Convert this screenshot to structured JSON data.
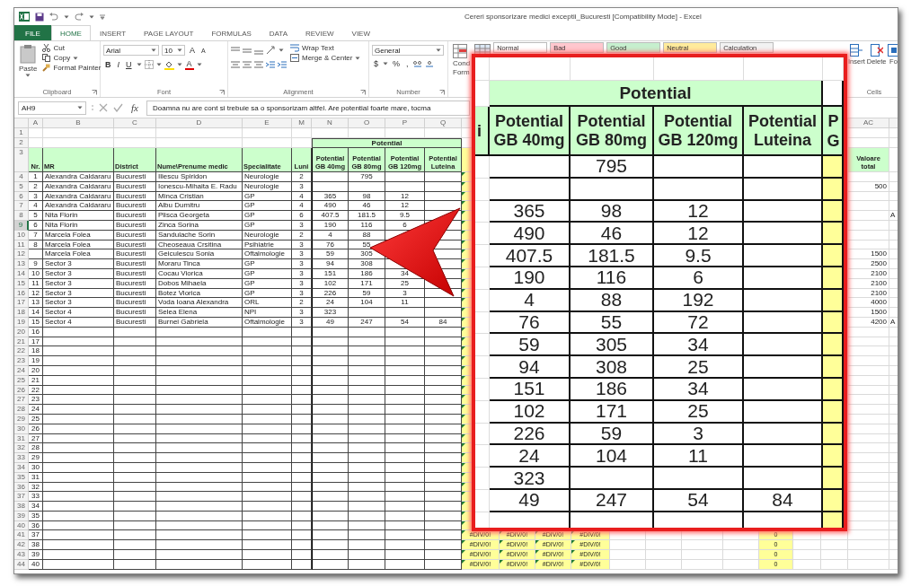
{
  "title_bar": {
    "title": "Cereri sponsorizare medici exceptii_Bucuresti  [Compatibility Mode] - Excel"
  },
  "ribbon_tabs": [
    {
      "label": "FILE",
      "kind": "file",
      "selected": false
    },
    {
      "label": "HOME",
      "kind": "tab",
      "selected": true
    },
    {
      "label": "INSERT",
      "kind": "tab",
      "selected": false
    },
    {
      "label": "PAGE LAYOUT",
      "kind": "tab",
      "selected": false
    },
    {
      "label": "FORMULAS",
      "kind": "tab",
      "selected": false
    },
    {
      "label": "DATA",
      "kind": "tab",
      "selected": false
    },
    {
      "label": "REVIEW",
      "kind": "tab",
      "selected": false
    },
    {
      "label": "VIEW",
      "kind": "tab",
      "selected": false
    }
  ],
  "ribbon": {
    "clipboard": {
      "paste": "Paste",
      "cut": "Cut",
      "copy": "Copy",
      "format_painter": "Format Painter",
      "label": "Clipboard"
    },
    "font": {
      "name": "Arial",
      "size": "10",
      "grow": "A",
      "shrink": "A",
      "bold": "B",
      "italic": "I",
      "underline": "U",
      "font_color": "A",
      "label": "Font"
    },
    "alignment": {
      "wrap": "Wrap Text",
      "merge": "Merge & Center",
      "label": "Alignment"
    },
    "number": {
      "format": "General",
      "currency": "$",
      "percent": "%",
      "comma": ",",
      "label": "Number"
    },
    "styles": {
      "conditional": [
        "Cond",
        "Form"
      ],
      "gallery": [
        {
          "label": "Normal",
          "color": "#ffffff"
        },
        {
          "label": "Bad",
          "color": "#ffc7ce"
        },
        {
          "label": "Good",
          "color": "#c6efce"
        },
        {
          "label": "Neutral",
          "color": "#ffeb9c"
        },
        {
          "label": "Calculation",
          "color": "#f2f2f2"
        }
      ]
    },
    "cells": {
      "insert": "Insert",
      "delete": "Delete",
      "format": "Fo",
      "label": "Cells"
    }
  },
  "formula_bar": {
    "name_box": "AH9",
    "function_label": "fx",
    "formula": "Doamna nu are cont si trebuie sa o sponsorizam altfel. Are potential foarte mare, tocma"
  },
  "sheet": {
    "column_headers": [
      "A",
      "B",
      "C",
      "D",
      "E",
      "M",
      "N",
      "O",
      "P",
      "Q",
      "AC"
    ],
    "row1": {
      "number": "1",
      "selected": false
    },
    "band_row": {
      "number": "2",
      "selected": false,
      "title": "Potential"
    },
    "header_row": {
      "number": "3",
      "selected": false,
      "nr": "Nr.",
      "mr": "MR",
      "district": "District",
      "doctor": "Nume\\Prenume medic",
      "specialty": "Specialitate",
      "months": "Luni",
      "gb40": "Potential GB 40mg",
      "gb80": "Potential GB 80mg",
      "gb120": "Potential GB 120mg",
      "luteina": "Potential Luteina",
      "total": "Valoare total"
    },
    "rows": [
      {
        "number": "4",
        "selected": false,
        "nr": "1",
        "mr": "Alexandra Caldararu",
        "district": "Bucuresti",
        "doctor": "Iliescu Spiridon",
        "specialty": "Neurologie",
        "months": "2",
        "gb80": "795"
      },
      {
        "number": "5",
        "selected": false,
        "nr": "2",
        "mr": "Alexandra Caldararu",
        "district": "Bucuresti",
        "doctor": "Ionescu-Mihaita E. Radu",
        "specialty": "Neurologie",
        "months": "3",
        "total": "500"
      },
      {
        "number": "6",
        "selected": false,
        "nr": "3",
        "mr": "Alexandra Caldararu",
        "district": "Bucuresti",
        "doctor": "Minca Cristian",
        "specialty": "GP",
        "months": "4",
        "gb40": "365",
        "gb80": "98",
        "gb120": "12"
      },
      {
        "number": "7",
        "selected": false,
        "nr": "4",
        "mr": "Alexandra Caldararu",
        "district": "Bucuresti",
        "doctor": "Albu Dumitru",
        "specialty": "GP",
        "months": "4",
        "gb40": "490",
        "gb80": "46",
        "gb120": "12"
      },
      {
        "number": "8",
        "selected": false,
        "nr": "5",
        "mr": "Nita Florin",
        "district": "Bucuresti",
        "doctor": "Plisca Georgeta",
        "specialty": "GP",
        "months": "6",
        "gb40": "407.5",
        "gb80": "181.5",
        "gb120": "9.5",
        "col_ad": "A"
      },
      {
        "number": "9",
        "selected": true,
        "nr": "6",
        "mr": "Nita Florin",
        "district": "Bucuresti",
        "doctor": "Zinca Sorina",
        "specialty": "GP",
        "months": "3",
        "gb40": "190",
        "gb80": "116",
        "gb120": "6"
      },
      {
        "number": "10",
        "selected": false,
        "nr": "7",
        "mr": "Marcela Folea",
        "district": "Bucuresti",
        "doctor": "Sandulache Sorin",
        "specialty": "Neurologie",
        "months": "2",
        "gb40": "4",
        "gb80": "88"
      },
      {
        "number": "11",
        "selected": false,
        "nr": "8",
        "mr": "Marcela Folea",
        "district": "Bucuresti",
        "doctor": "Cheoseaua Crsitina",
        "specialty": "Psihiatrie",
        "months": "3",
        "gb40": "76",
        "gb80": "55"
      },
      {
        "number": "12",
        "selected": false,
        "mr": "Marcela Folea",
        "district": "Bucuresti",
        "doctor": "Geiculescu Sonia",
        "specialty": "Oftalmologie",
        "months": "3",
        "gb40": "59",
        "gb80": "305",
        "total": "1500"
      },
      {
        "number": "13",
        "selected": false,
        "nr": "9",
        "mr": "Sector 3",
        "district": "Bucuresti",
        "doctor": "Moraru Tinca",
        "specialty": "GP",
        "months": "3",
        "gb40": "94",
        "gb80": "308",
        "total": "2500"
      },
      {
        "number": "14",
        "selected": false,
        "nr": "10",
        "mr": "Sector 3",
        "district": "Bucuresti",
        "doctor": "Cocau Viorica",
        "specialty": "GP",
        "months": "3",
        "gb40": "151",
        "gb80": "186",
        "gb120": "34",
        "total": "2100"
      },
      {
        "number": "15",
        "selected": false,
        "nr": "11",
        "mr": "Sector 3",
        "district": "Bucuresti",
        "doctor": "Dobos Mihaela",
        "specialty": "GP",
        "months": "3",
        "gb40": "102",
        "gb80": "171",
        "gb120": "25",
        "total": "2100"
      },
      {
        "number": "16",
        "selected": false,
        "nr": "12",
        "mr": "Sector 3",
        "district": "Bucuresti",
        "doctor": "Botez Viorica",
        "specialty": "GP",
        "months": "3",
        "gb40": "226",
        "gb80": "59",
        "gb120": "3",
        "total": "2100"
      },
      {
        "number": "17",
        "selected": false,
        "nr": "13",
        "mr": "Sector 3",
        "district": "Bucuresti",
        "doctor": "Voda Ioana Alexandra",
        "specialty": "ORL",
        "months": "2",
        "gb40": "24",
        "gb80": "104",
        "gb120": "11",
        "total": "4000"
      },
      {
        "number": "18",
        "selected": false,
        "nr": "14",
        "mr": "Sector 4",
        "district": "Bucuresti",
        "doctor": "Selea Elena",
        "specialty": "NPI",
        "months": "3",
        "gb40": "323",
        "total": "1500"
      },
      {
        "number": "19",
        "selected": false,
        "nr": "15",
        "mr": "Sector 4",
        "district": "Bucuresti",
        "doctor": "Burnei Gabriela",
        "specialty": "Oftalmologie",
        "months": "3",
        "gb40": "49",
        "gb80": "247",
        "gb120": "54",
        "luteina": "84",
        "total": "4200",
        "col_ad": "A"
      },
      {
        "number": "20",
        "selected": false,
        "nr": "16"
      },
      {
        "number": "21",
        "selected": false,
        "nr": "17"
      },
      {
        "number": "22",
        "selected": false,
        "nr": "18"
      },
      {
        "number": "23",
        "selected": false,
        "nr": "19"
      },
      {
        "number": "24",
        "selected": false,
        "nr": "20"
      },
      {
        "number": "25",
        "selected": false,
        "nr": "21"
      },
      {
        "number": "26",
        "selected": false,
        "nr": "22"
      },
      {
        "number": "27",
        "selected": false,
        "nr": "23"
      },
      {
        "number": "28",
        "selected": false,
        "nr": "24"
      },
      {
        "number": "29",
        "selected": false,
        "nr": "25"
      },
      {
        "number": "30",
        "selected": false,
        "nr": "26"
      },
      {
        "number": "31",
        "selected": false,
        "nr": "27"
      },
      {
        "number": "32",
        "selected": false,
        "nr": "28"
      },
      {
        "number": "33",
        "selected": false,
        "nr": "29"
      },
      {
        "number": "34",
        "selected": false,
        "nr": "30"
      },
      {
        "number": "35",
        "selected": false,
        "nr": "31"
      },
      {
        "number": "36",
        "selected": false,
        "nr": "32"
      },
      {
        "number": "37",
        "selected": false,
        "nr": "33"
      },
      {
        "number": "38",
        "selected": false,
        "nr": "34"
      },
      {
        "number": "39",
        "selected": false,
        "nr": "35"
      },
      {
        "number": "40",
        "selected": false,
        "nr": "36"
      },
      {
        "number": "41",
        "selected": false,
        "nr": "37",
        "div_errors": [
          "#DIV/0!",
          "#DIV/0!",
          "#DIV/0!",
          "#DIV/0!"
        ],
        "zero": "0"
      },
      {
        "number": "42",
        "selected": false,
        "nr": "38",
        "div_errors": [
          "#DIV/0!",
          "#DIV/0!",
          "#DIV/0!",
          "#DIV/0!"
        ],
        "zero": "0"
      },
      {
        "number": "43",
        "selected": false,
        "nr": "39",
        "div_errors": [
          "#DIV/0!",
          "#DIV/0!",
          "#DIV/0!",
          "#DIV/0!"
        ],
        "zero": "0"
      },
      {
        "number": "44",
        "selected": false,
        "nr": "40",
        "div_errors": [
          "#DIV/0!",
          "#DIV/0!",
          "#DIV/0!",
          "#DIV/0!"
        ],
        "zero": "0"
      }
    ]
  },
  "zoom_callout": {
    "band_title": "Potential",
    "left_header": "i",
    "headers": [
      "Potential GB 40mg",
      "Potential GB 80mg",
      "Potential GB 120mg",
      "Potential Luteina"
    ],
    "right_header": "P G",
    "rows": [
      {
        "gb80": "795"
      },
      {},
      {
        "gb40": "365",
        "gb80": "98",
        "gb120": "12"
      },
      {
        "gb40": "490",
        "gb80": "46",
        "gb120": "12"
      },
      {
        "gb40": "407.5",
        "gb80": "181.5",
        "gb120": "9.5"
      },
      {
        "gb40": "190",
        "gb80": "116",
        "gb120": "6"
      },
      {
        "gb40": "4",
        "gb80": "88",
        "gb120": "192"
      },
      {
        "gb40": "76",
        "gb80": "55",
        "gb120": "72"
      },
      {
        "gb40": "59",
        "gb80": "305",
        "gb120": "34"
      },
      {
        "gb40": "94",
        "gb80": "308",
        "gb120": "25"
      },
      {
        "gb40": "151",
        "gb80": "186",
        "gb120": "34"
      },
      {
        "gb40": "102",
        "gb80": "171",
        "gb120": "25"
      },
      {
        "gb40": "226",
        "gb80": "59",
        "gb120": "3"
      },
      {
        "gb40": "24",
        "gb80": "104",
        "gb120": "11"
      },
      {
        "gb40": "323"
      },
      {
        "gb40": "49",
        "gb80": "247",
        "gb120": "54",
        "luteina": "84"
      },
      {}
    ]
  }
}
